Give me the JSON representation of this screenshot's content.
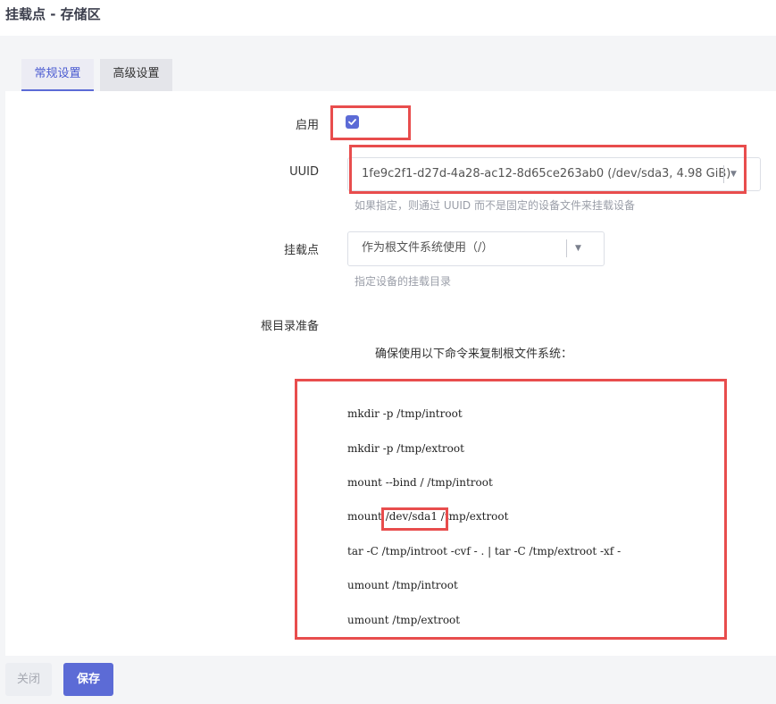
{
  "header": {
    "title": "挂载点 - 存储区"
  },
  "tabs": [
    {
      "label": "常规设置",
      "active": true
    },
    {
      "label": "高级设置",
      "active": false
    }
  ],
  "form": {
    "enable": {
      "label": "启用",
      "checked": true
    },
    "uuid": {
      "label": "UUID",
      "value": "1fe9c2f1-d27d-4a28-ac12-8d65ce263ab0 (/dev/sda3, 4.98 GiB)",
      "hint": "如果指定，则通过 UUID 而不是固定的设备文件来挂载设备"
    },
    "mountpoint": {
      "label": "挂载点",
      "value": "作为根文件系统使用（/）",
      "hint": "指定设备的挂载目录"
    },
    "rootprep": {
      "label": "根目录准备",
      "intro": "确保使用以下命令来复制根文件系统：",
      "commands": [
        "mkdir -p /tmp/introot",
        "mkdir -p /tmp/extroot",
        "mount --bind / /tmp/introot",
        "mount /dev/sda1 /tmp/extroot",
        "tar -C /tmp/introot -cvf - . | tar -C /tmp/extroot -xf -",
        "umount /tmp/introot",
        "umount /tmp/extroot"
      ]
    }
  },
  "footer": {
    "close_label": "关闭",
    "save_label": "保存"
  },
  "colors": {
    "accent": "#5c6bd6",
    "highlight": "#e84d4d"
  },
  "icons": {
    "checkbox": "checkmark-icon",
    "dropdown": "caret-down-icon"
  }
}
